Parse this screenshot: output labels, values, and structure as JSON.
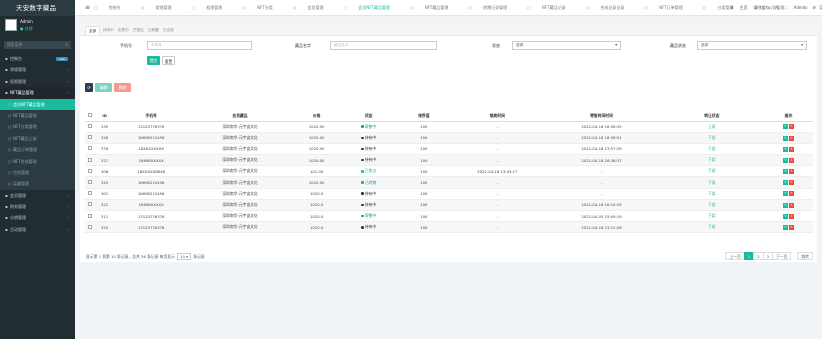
{
  "brand": "天安数字藏品",
  "user": {
    "name": "Admin",
    "status": "● 在线"
  },
  "search_placeholder": "搜索菜单",
  "menu": [
    {
      "label": "控制台",
      "badge": "new",
      "icon": "▪",
      "type": "top"
    },
    {
      "label": "常规管理",
      "icon": "▪",
      "type": "top"
    },
    {
      "label": "权限管理",
      "icon": "▪",
      "type": "top"
    },
    {
      "label": "NFT藏品管理",
      "icon": "▪",
      "type": "parent"
    },
    {
      "label": "会员NFT藏品管理",
      "type": "sub_on"
    },
    {
      "label": "NFT藏品管理",
      "type": "sub"
    },
    {
      "label": "NFT分类管理",
      "type": "sub"
    },
    {
      "label": "NFT藏品上架",
      "type": "sub"
    },
    {
      "label": "藏品订单管理",
      "type": "sub"
    },
    {
      "label": "NFT合成管理",
      "type": "sub"
    },
    {
      "label": "空投管理",
      "type": "sub"
    },
    {
      "label": "盲盒管理",
      "type": "sub"
    },
    {
      "label": "会员管理",
      "icon": "▪",
      "type": "top"
    },
    {
      "label": "财务管理",
      "icon": "▪",
      "type": "top"
    },
    {
      "label": "分销管理",
      "icon": "▪",
      "type": "top"
    },
    {
      "label": "活动管理",
      "icon": "▪",
      "type": "top"
    }
  ],
  "topbar": {
    "tabs": [
      "控制台",
      "常规管理",
      "权限管理",
      "NFT分类",
      "会员管理",
      "会员NFT藏品管理",
      "NFT藏品管理",
      "转赠记录管理",
      "NFT藏品记录",
      "合成记录记录",
      "NFT订单管理",
      "分类管理",
      "公告管理",
      "盲盒订单管理",
      "NFT藏品订单管理"
    ],
    "right": [
      "☰",
      "主页",
      "清除缓存",
      "⇱",
      "⛶",
      "Admin",
      "⚙"
    ]
  },
  "panel_tabs": [
    "全部",
    "持有中",
    "出售中",
    "已售出",
    "已转赠",
    "已合成"
  ],
  "filters": {
    "phone_label": "手机号",
    "phone_placeholder": "手机号",
    "name_label": "藏品名字",
    "name_placeholder": "藏品名字",
    "status_label": "状态",
    "status_value": "选择",
    "type_label": "藏品状态",
    "type_value": "选择",
    "submit": "提交",
    "reset": "重置"
  },
  "toolbar": {
    "refresh": "⟳",
    "edit": "编辑",
    "delete": "删除"
  },
  "table": {
    "headers": [
      "",
      "ID",
      "手机号",
      "会员藏品",
      "价格",
      "状态",
      "排序值",
      "锁卖时间",
      "寄售时间时间",
      "转让状态",
      "操作"
    ],
    "rows": [
      [
        "335",
        "13125776376",
        "深圳南华·元宇宙文化",
        "1020.00",
        "寄售中",
        "#1c9a70",
        "100",
        "-",
        "2022-04-18 16:56:35",
        "上架"
      ],
      [
        "326",
        "18696210456",
        "深圳南华·元宇宙文化",
        "1020.00",
        "持有中",
        "#333333",
        "100",
        "-",
        "2022-04-18 16:36:51",
        "下架"
      ],
      [
        "376",
        "18XXXXXXXX",
        "深圳南华·元宇宙文化",
        "1020.00",
        "持有中",
        "#333333",
        "100",
        "-",
        "2022-04-18 13:57:39",
        "下架"
      ],
      [
        "327",
        "18696XXXXX",
        "深圳南华·元宇宙文化",
        "1020.00",
        "持有中",
        "#333333",
        "100",
        "-",
        "2022-04-18 16:36:37",
        "下架"
      ],
      [
        "306",
        "18XXXXX8848",
        "深圳南华·元宇宙文化",
        "101.00",
        "已售出",
        "#18bc9c",
        "100",
        "2022-04-18 13:43:17",
        "-",
        "下架"
      ],
      [
        "325",
        "18696210456",
        "深圳南华·元宇宙文化",
        "1020.00",
        "已转赠",
        "#3c8dbc",
        "100",
        "-",
        "-",
        "下架"
      ],
      [
        "301",
        "18696210456",
        "深圳南华·元宇宙文化",
        "1020.0",
        "持有中",
        "#333333",
        "100",
        "-",
        "-",
        "下架"
      ],
      [
        "322",
        "18696XXXXX",
        "深圳南华·元宇宙文化",
        "1020.0",
        "持有中",
        "#333333",
        "100",
        "-",
        "2022-04-16 16:14:25",
        "下架"
      ],
      [
        "311",
        "13125776376",
        "深圳南华·元宇宙文化",
        "1020.0",
        "寄售中",
        "#1c9a70",
        "100",
        "-",
        "2022-04-05 15:09:19",
        "下架"
      ],
      [
        "320",
        "13125776376",
        "深圳南华·元宇宙文化",
        "1020.0",
        "持有中",
        "#333333",
        "100",
        "-",
        "2022-04-16 13:12:26",
        "下架"
      ]
    ]
  },
  "pagination": {
    "summary": "显示第 1 到第 10 条记录，总共 36 条记录 每页显示",
    "page_size": "10 ▾",
    "suffix": "条记录",
    "prev": "上一页",
    "pages": [
      "1",
      "2",
      "3"
    ],
    "next": "下一页",
    "goto": "跳转"
  }
}
